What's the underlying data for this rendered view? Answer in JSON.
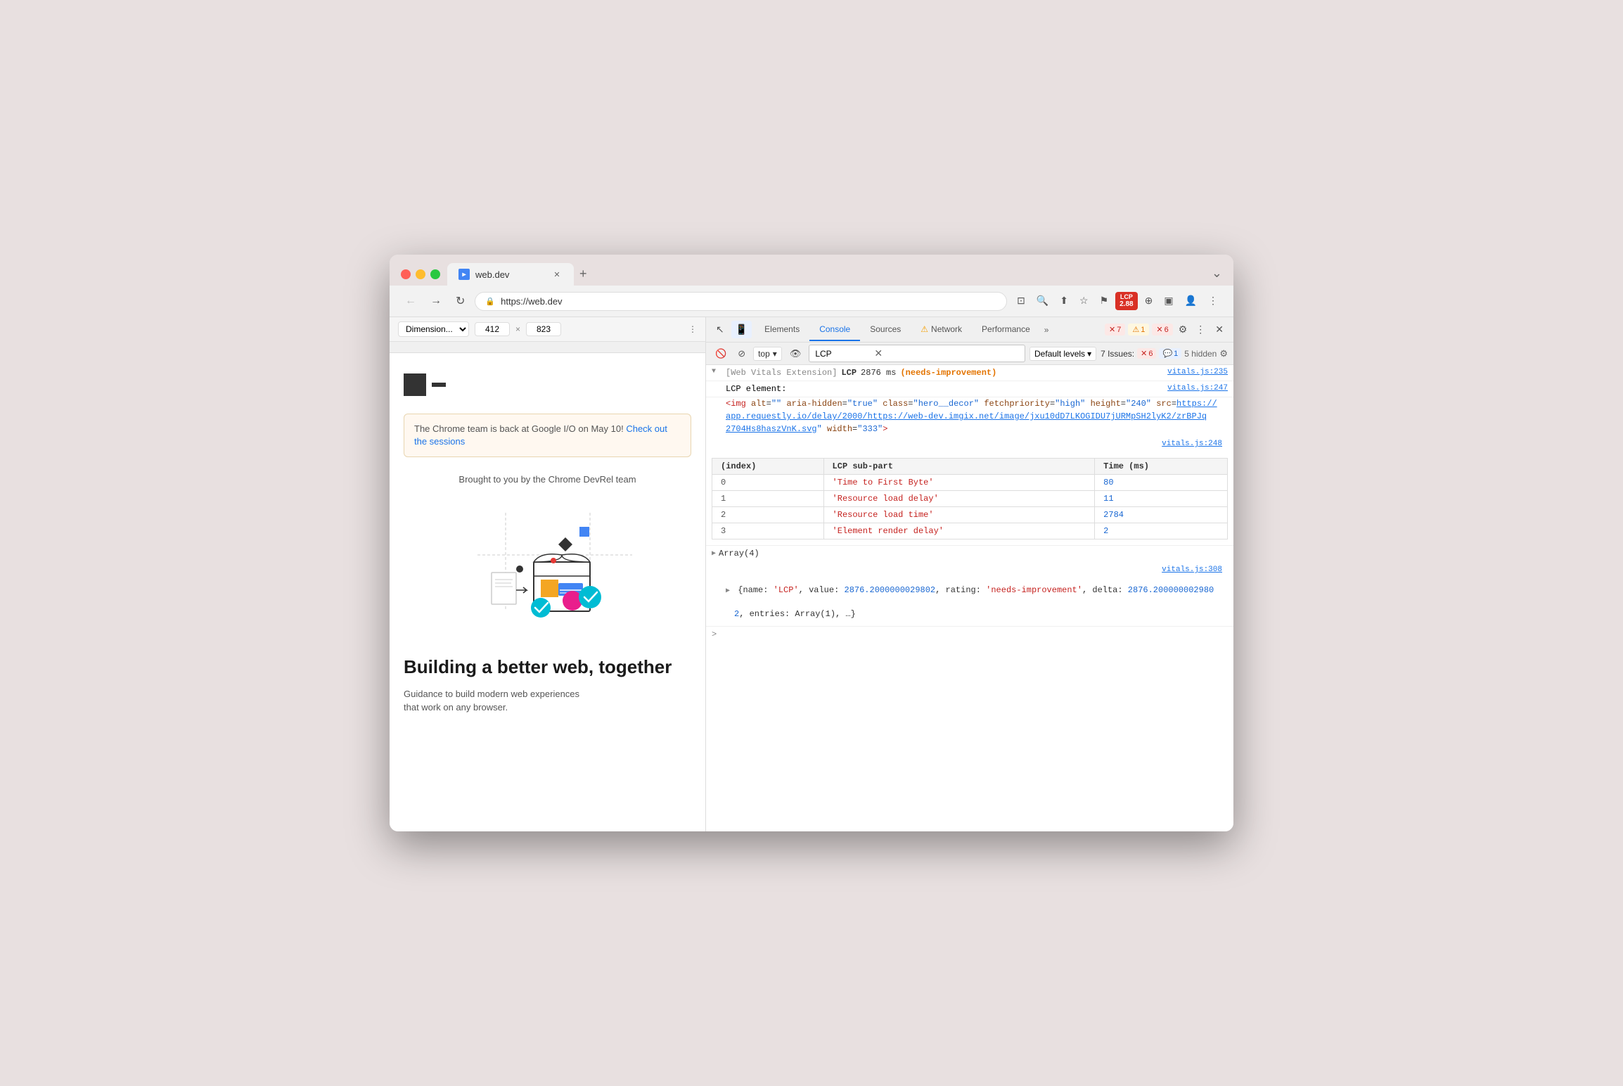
{
  "browser": {
    "tab_title": "web.dev",
    "tab_favicon": "▸",
    "url": "https://web.dev",
    "new_tab_label": "+",
    "window_chevron": "⌄"
  },
  "nav": {
    "back_label": "←",
    "forward_label": "→",
    "reload_label": "↻",
    "lock_icon": "🔒",
    "address": "https://web.dev",
    "cast_icon": "⊡",
    "search_icon": "🔍",
    "share_icon": "⬆",
    "bookmark_icon": "☆",
    "flag_icon": "⚑",
    "lcp_label": "LCP",
    "lcp_value": "2.88",
    "extensions_icon": "⊕",
    "split_icon": "▣",
    "avatar_icon": "●",
    "more_icon": "⋮"
  },
  "dim_bar": {
    "dimension_label": "Dimension...",
    "width": "412",
    "separator": "×",
    "height": "823",
    "more_icon": "⋮"
  },
  "page": {
    "notification": "The Chrome team is back at Google I/O on May 10!",
    "notification_link": "Check out the sessions",
    "devrel_text": "Brought to you by the Chrome DevRel team",
    "heading": "Building a better web, together",
    "subtext_line1": "Guidance to build modern web experiences",
    "subtext_line2": "that work on any browser."
  },
  "devtools": {
    "inspect_icon": "↖",
    "device_icon": "📱",
    "tabs": [
      {
        "label": "Elements",
        "active": false
      },
      {
        "label": "Console",
        "active": true
      },
      {
        "label": "Sources",
        "active": false
      },
      {
        "label": "Network",
        "active": false,
        "warning": true
      },
      {
        "label": "Performance",
        "active": false
      }
    ],
    "more_tabs": "»",
    "badge_errors": "7",
    "badge_warnings": "1",
    "badge_errors2": "6",
    "settings_icon": "⚙",
    "more_icon": "⋮",
    "close_icon": "✕"
  },
  "console_toolbar": {
    "clear_icon": "🚫",
    "stop_icon": "⊘",
    "context": "top",
    "context_chevron": "▾",
    "eye_icon": "👁",
    "filter_placeholder": "LCP",
    "filter_value": "LCP",
    "filter_clear": "✕",
    "levels_label": "Default levels",
    "levels_chevron": "▾",
    "issues_label": "7 Issues:",
    "issue_errors": "6",
    "issue_info": "1",
    "hidden_label": "5 hidden",
    "settings_icon": "⚙"
  },
  "console_output": {
    "entry1": {
      "file_ref": "vitals.js:235",
      "prefix": "[Web Vitals Extension]",
      "metric": "LCP",
      "value": "2876 ms",
      "status": "(needs-improvement)"
    },
    "entry2": {
      "file_ref": "vitals.js:247",
      "label": "LCP element:"
    },
    "img_tag": {
      "tag": "<img",
      "attrs": [
        {
          "name": "alt",
          "value": "\"\""
        },
        {
          "name": "aria-hidden",
          "value": "\"true\""
        },
        {
          "name": "class",
          "value": "\"hero__decor\""
        },
        {
          "name": "fetchpriority",
          "value": "\"high\""
        },
        {
          "name": "height",
          "value": "\"240\""
        },
        {
          "name": "src",
          "value": "\"https://app.requestl...\""
        }
      ],
      "src_link": "https://app.requestly.io/delay/2000/https://web-dev.imgix.net/image/jxu10dD7LKOGIDU7jURMpSH2lyK2/zrBPJq2704Hs8haszVnK.svg",
      "src_display1": "https://",
      "src_display2": "app.requestly.io/delay/2000/https://web-dev.imgix.net/image/jxu10dD7LKOGIDU7jURMpSH2lyK2/zrBPJq",
      "src_display3": "2704Hs8haszVnK.svg",
      "width_attr": "width",
      "width_val": "\"333\"",
      "close": ">"
    },
    "table": {
      "file_ref": "vitals.js:248",
      "headers": [
        "(index)",
        "LCP sub-part",
        "Time (ms)"
      ],
      "rows": [
        {
          "index": "0",
          "subpart": "'Time to First Byte'",
          "time": "80"
        },
        {
          "index": "1",
          "subpart": "'Resource load delay'",
          "time": "11"
        },
        {
          "index": "2",
          "subpart": "'Resource load time'",
          "time": "2784"
        },
        {
          "index": "3",
          "subpart": "'Element render delay'",
          "time": "2"
        }
      ]
    },
    "array_entry": {
      "label": "▶ Array(4)"
    },
    "obj_entry": {
      "file_ref": "vitals.js:308",
      "expand_symbol": "▶",
      "content": "{name: 'LCP', value: 2876.2000000029802, rating: 'needs-improvement', delta: 2876.200000002980",
      "content2": "2, entries: Array(1), …}"
    },
    "bottom_arrow": ">"
  }
}
